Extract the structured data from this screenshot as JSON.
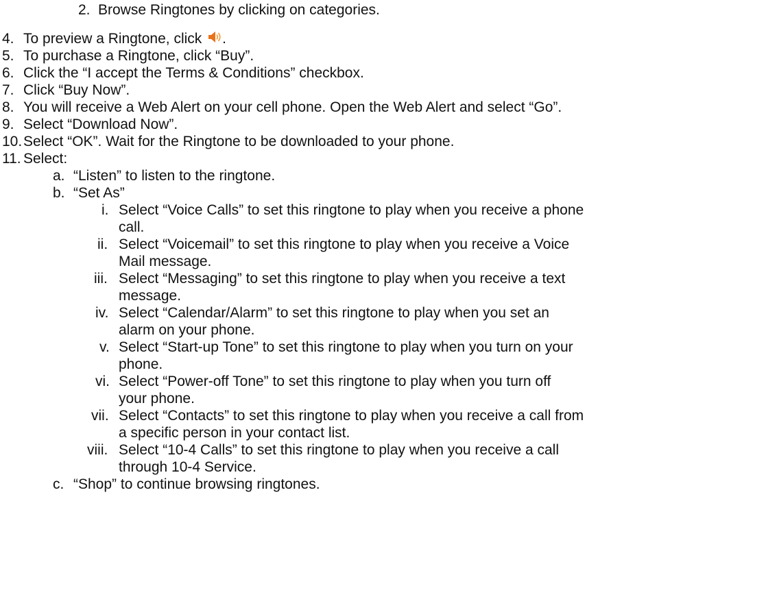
{
  "document": {
    "step2": {
      "label": "2.",
      "text": "Browse Ringtones by clicking on categories."
    },
    "step4": {
      "label": "4.",
      "text_before": "To preview a Ringtone, click",
      "text_after": "."
    },
    "step5": {
      "label": "5.",
      "text": "To purchase a Ringtone, click “Buy”."
    },
    "step6": {
      "label": "6.",
      "text": "Click the “I accept the Terms & Conditions” checkbox."
    },
    "step7": {
      "label": "7.",
      "text": "Click “Buy Now”."
    },
    "step8": {
      "label": "8.",
      "text": "You will receive a Web Alert on your cell phone.  Open the Web Alert and select “Go”."
    },
    "step9": {
      "label": "9.",
      "text": "Select “Download Now”."
    },
    "step10": {
      "label": "10.",
      "text": "Select “OK”.  Wait for the Ringtone to be downloaded to your phone."
    },
    "step11": {
      "label": "11.",
      "text": "Select:"
    },
    "sub_a": {
      "label": "a.",
      "text": "“Listen” to listen to the ringtone."
    },
    "sub_b": {
      "label": "b.",
      "text": "“Set As”"
    },
    "roman": [
      {
        "label": "i.",
        "line1": "Select “Voice Calls” to set this ringtone to play when you receive a phone",
        "line2": "call."
      },
      {
        "label": "ii.",
        "line1": "Select “Voicemail” to set this ringtone to play when you receive a Voice",
        "line2": "Mail message."
      },
      {
        "label": "iii.",
        "line1": "Select “Messaging” to set this ringtone to play when you receive a text",
        "line2": "message."
      },
      {
        "label": "iv.",
        "line1": "Select “Calendar/Alarm” to set this ringtone to play when you set an",
        "line2": "alarm on your phone."
      },
      {
        "label": "v.",
        "line1": "Select “Start-up Tone” to set this ringtone to play when you turn on your",
        "line2": "phone."
      },
      {
        "label": "vi.",
        "line1": "Select “Power-off Tone” to set this ringtone to play when you turn off",
        "line2": "your phone."
      },
      {
        "label": "vii.",
        "line1": "Select “Contacts” to set this ringtone to play when you receive a call from",
        "line2": "a specific person in your contact list."
      },
      {
        "label": "viii.",
        "line1": "Select “10-4 Calls” to set this ringtone to play when you receive a call",
        "line2": "through 10-4 Service."
      }
    ],
    "sub_c": {
      "label": "c.",
      "text": "“Shop” to continue browsing ringtones."
    },
    "icons": {
      "preview": "speaker-icon"
    },
    "colors": {
      "speaker": "#e8731c",
      "speaker_wave": "#f4a24a"
    }
  }
}
